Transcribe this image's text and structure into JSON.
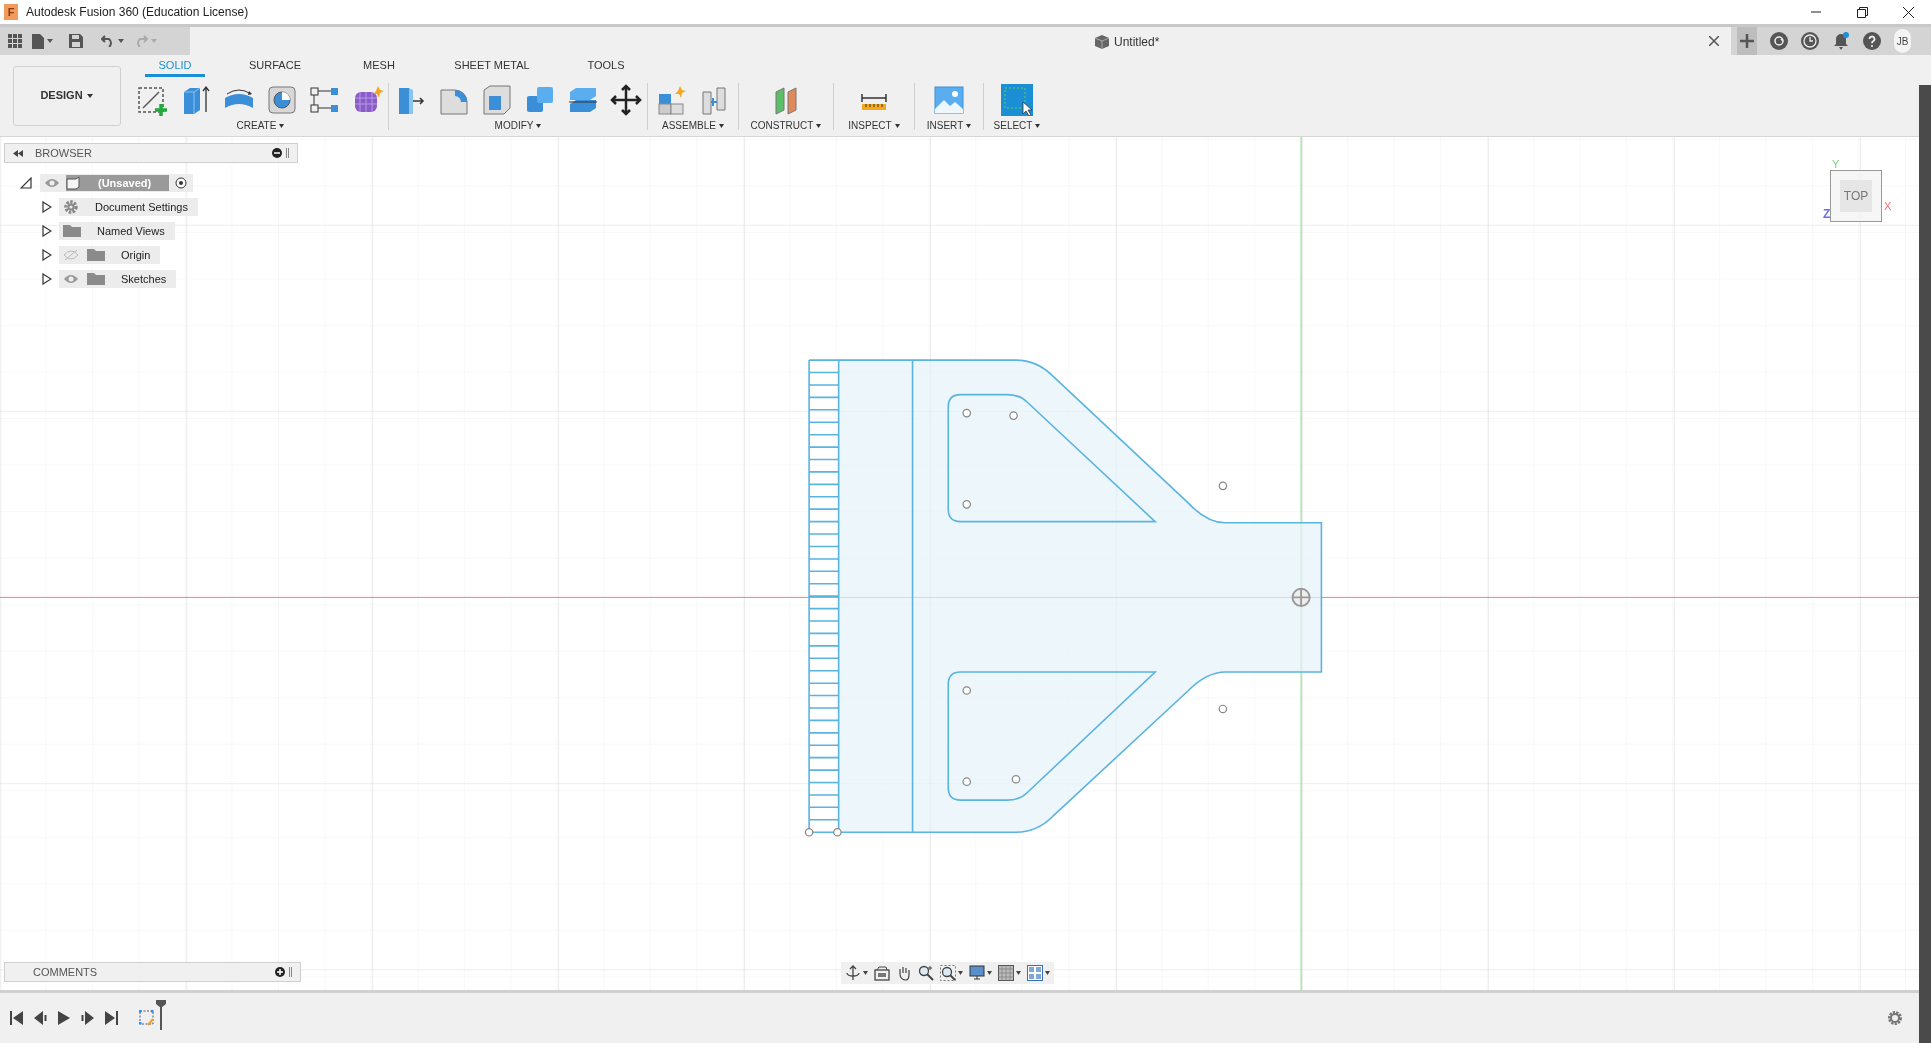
{
  "window": {
    "title": "Autodesk Fusion 360 (Education License)",
    "logo_letter": "F"
  },
  "document_tab": {
    "title": "Untitled*"
  },
  "user": {
    "initials": "JB"
  },
  "workspace": {
    "label": "DESIGN"
  },
  "toolbar_tabs": [
    {
      "label": "SOLID",
      "selected": true
    },
    {
      "label": "SURFACE",
      "selected": false
    },
    {
      "label": "MESH",
      "selected": false
    },
    {
      "label": "SHEET METAL",
      "selected": false
    },
    {
      "label": "TOOLS",
      "selected": false
    }
  ],
  "tool_groups": [
    {
      "label": "CREATE",
      "tools": [
        {
          "kind": "sketch"
        },
        {
          "kind": "extrude"
        },
        {
          "kind": "revolve"
        },
        {
          "kind": "hole"
        },
        {
          "kind": "pattern"
        },
        {
          "kind": "form"
        }
      ]
    },
    {
      "label": "MODIFY",
      "tools": [
        {
          "kind": "presspull"
        },
        {
          "kind": "fillet"
        },
        {
          "kind": "shell"
        },
        {
          "kind": "combine"
        },
        {
          "kind": "offset"
        },
        {
          "kind": "move"
        }
      ]
    },
    {
      "label": "ASSEMBLE",
      "tools": [
        {
          "kind": "component"
        },
        {
          "kind": "joint"
        }
      ]
    },
    {
      "label": "CONSTRUCT",
      "tools": [
        {
          "kind": "plane"
        }
      ]
    },
    {
      "label": "INSPECT",
      "tools": [
        {
          "kind": "measure"
        }
      ]
    },
    {
      "label": "INSERT",
      "tools": [
        {
          "kind": "image"
        }
      ]
    },
    {
      "label": "SELECT",
      "tools": [
        {
          "kind": "select"
        }
      ]
    }
  ],
  "browser": {
    "title": "BROWSER",
    "root": {
      "label": "(Unsaved)",
      "visible": true,
      "expanded": true,
      "children": [
        {
          "label": "Document Settings",
          "kind": "settings",
          "expanded": false
        },
        {
          "label": "Named Views",
          "kind": "folder",
          "expanded": false
        },
        {
          "label": "Origin",
          "kind": "folder",
          "visible": false,
          "expanded": false
        },
        {
          "label": "Sketches",
          "kind": "folder",
          "visible": true,
          "expanded": false
        }
      ]
    }
  },
  "view_cube": {
    "face": "TOP",
    "axes": [
      {
        "label": "Y",
        "color": "#7ed67e"
      },
      {
        "label": "X",
        "color": "#f07070"
      },
      {
        "label": "Z",
        "color": "#6b6bf0"
      }
    ]
  },
  "comments": {
    "title": "COMMENTS"
  }
}
